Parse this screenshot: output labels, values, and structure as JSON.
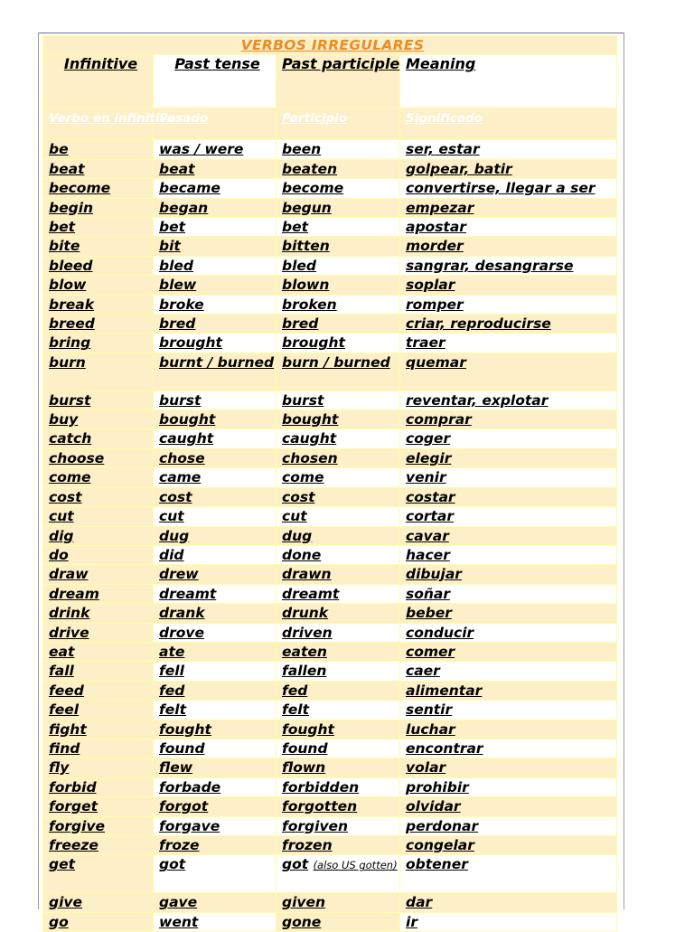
{
  "document": {
    "title": "VERBOS IRREGULARES",
    "title_color": "#ed8b23"
  },
  "table": {
    "headers_en": [
      "Infinitive",
      "Past tense",
      "Past participle",
      "Meaning"
    ],
    "headers_es": [
      "Verbo en infinitivo",
      "Pasado",
      "Participio",
      "Significado"
    ],
    "rows": [
      {
        "infinitive": "be",
        "past": "was / were",
        "participle": "been",
        "meaning": "ser, estar"
      },
      {
        "infinitive": "beat",
        "past": "beat",
        "participle": "beaten",
        "meaning": "golpear, batir"
      },
      {
        "infinitive": "become",
        "past": "became",
        "participle": "become",
        "meaning": "convertirse, llegar a ser"
      },
      {
        "infinitive": "begin",
        "past": "began",
        "participle": "begun",
        "meaning": "empezar"
      },
      {
        "infinitive": "bet",
        "past": "bet",
        "participle": "bet",
        "meaning": "apostar"
      },
      {
        "infinitive": "bite",
        "past": "bit",
        "participle": "bitten",
        "meaning": "morder"
      },
      {
        "infinitive": "bleed",
        "past": "bled",
        "participle": "bled",
        "meaning": "sangrar, desangrarse"
      },
      {
        "infinitive": "blow",
        "past": "blew",
        "participle": "blown",
        "meaning": "soplar"
      },
      {
        "infinitive": "break",
        "past": "broke",
        "participle": "broken",
        "meaning": "romper"
      },
      {
        "infinitive": "breed",
        "past": "bred",
        "participle": "bred",
        "meaning": "criar, reproducirse"
      },
      {
        "infinitive": "bring",
        "past": "brought",
        "participle": "brought",
        "meaning": "traer"
      },
      {
        "infinitive": "burn",
        "past": "burnt / burned",
        "participle": "burn / burned",
        "meaning": "quemar",
        "tall": true
      },
      {
        "infinitive": "burst",
        "past": "burst",
        "participle": "burst",
        "meaning": "reventar, explotar"
      },
      {
        "infinitive": "buy",
        "past": "bought",
        "participle": "bought",
        "meaning": "comprar"
      },
      {
        "infinitive": "catch",
        "past": "caught",
        "participle": "caught",
        "meaning": "coger"
      },
      {
        "infinitive": "choose",
        "past": "chose",
        "participle": "chosen",
        "meaning": "elegir"
      },
      {
        "infinitive": "come",
        "past": "came",
        "participle": "come",
        "meaning": "venir"
      },
      {
        "infinitive": "cost",
        "past": "cost",
        "participle": "cost",
        "meaning": "costar"
      },
      {
        "infinitive": "cut",
        "past": "cut",
        "participle": "cut",
        "meaning": "cortar"
      },
      {
        "infinitive": "dig",
        "past": "dug",
        "participle": "dug",
        "meaning": "cavar"
      },
      {
        "infinitive": "do",
        "past": "did",
        "participle": "done",
        "meaning": "hacer"
      },
      {
        "infinitive": "draw",
        "past": "drew",
        "participle": "drawn",
        "meaning": "dibujar"
      },
      {
        "infinitive": "dream",
        "past": "dreamt",
        "participle": "dreamt",
        "meaning": "soñar"
      },
      {
        "infinitive": "drink",
        "past": "drank",
        "participle": "drunk",
        "meaning": "beber"
      },
      {
        "infinitive": "drive",
        "past": "drove",
        "participle": "driven",
        "meaning": "conducir"
      },
      {
        "infinitive": "eat",
        "past": "ate",
        "participle": "eaten",
        "meaning": "comer"
      },
      {
        "infinitive": "fall",
        "past": "fell",
        "participle": "fallen",
        "meaning": "caer"
      },
      {
        "infinitive": "feed",
        "past": "fed",
        "participle": "fed",
        "meaning": "alimentar"
      },
      {
        "infinitive": "feel",
        "past": "felt",
        "participle": "felt",
        "meaning": "sentir"
      },
      {
        "infinitive": "fight",
        "past": "fought",
        "participle": "fought",
        "meaning": "luchar"
      },
      {
        "infinitive": "find",
        "past": "found",
        "participle": "found",
        "meaning": "encontrar"
      },
      {
        "infinitive": "fly",
        "past": "flew",
        "participle": "flown",
        "meaning": "volar"
      },
      {
        "infinitive": "forbid",
        "past": "forbade",
        "participle": "forbidden",
        "meaning": "prohibir"
      },
      {
        "infinitive": "forget",
        "past": "forgot",
        "participle": "forgotten",
        "meaning": "olvidar"
      },
      {
        "infinitive": "forgive",
        "past": "forgave",
        "participle": "forgiven",
        "meaning": "perdonar"
      },
      {
        "infinitive": "freeze",
        "past": "froze",
        "participle": "frozen",
        "meaning": "congelar"
      },
      {
        "infinitive": "get",
        "past": "got",
        "participle": "got",
        "participle_note": "(also US gotten)",
        "meaning": "obtener",
        "tall": true
      },
      {
        "infinitive": "give",
        "past": "gave",
        "participle": "given",
        "meaning": "dar"
      },
      {
        "infinitive": "go",
        "past": "went",
        "participle": "gone",
        "meaning": "ir"
      }
    ]
  }
}
